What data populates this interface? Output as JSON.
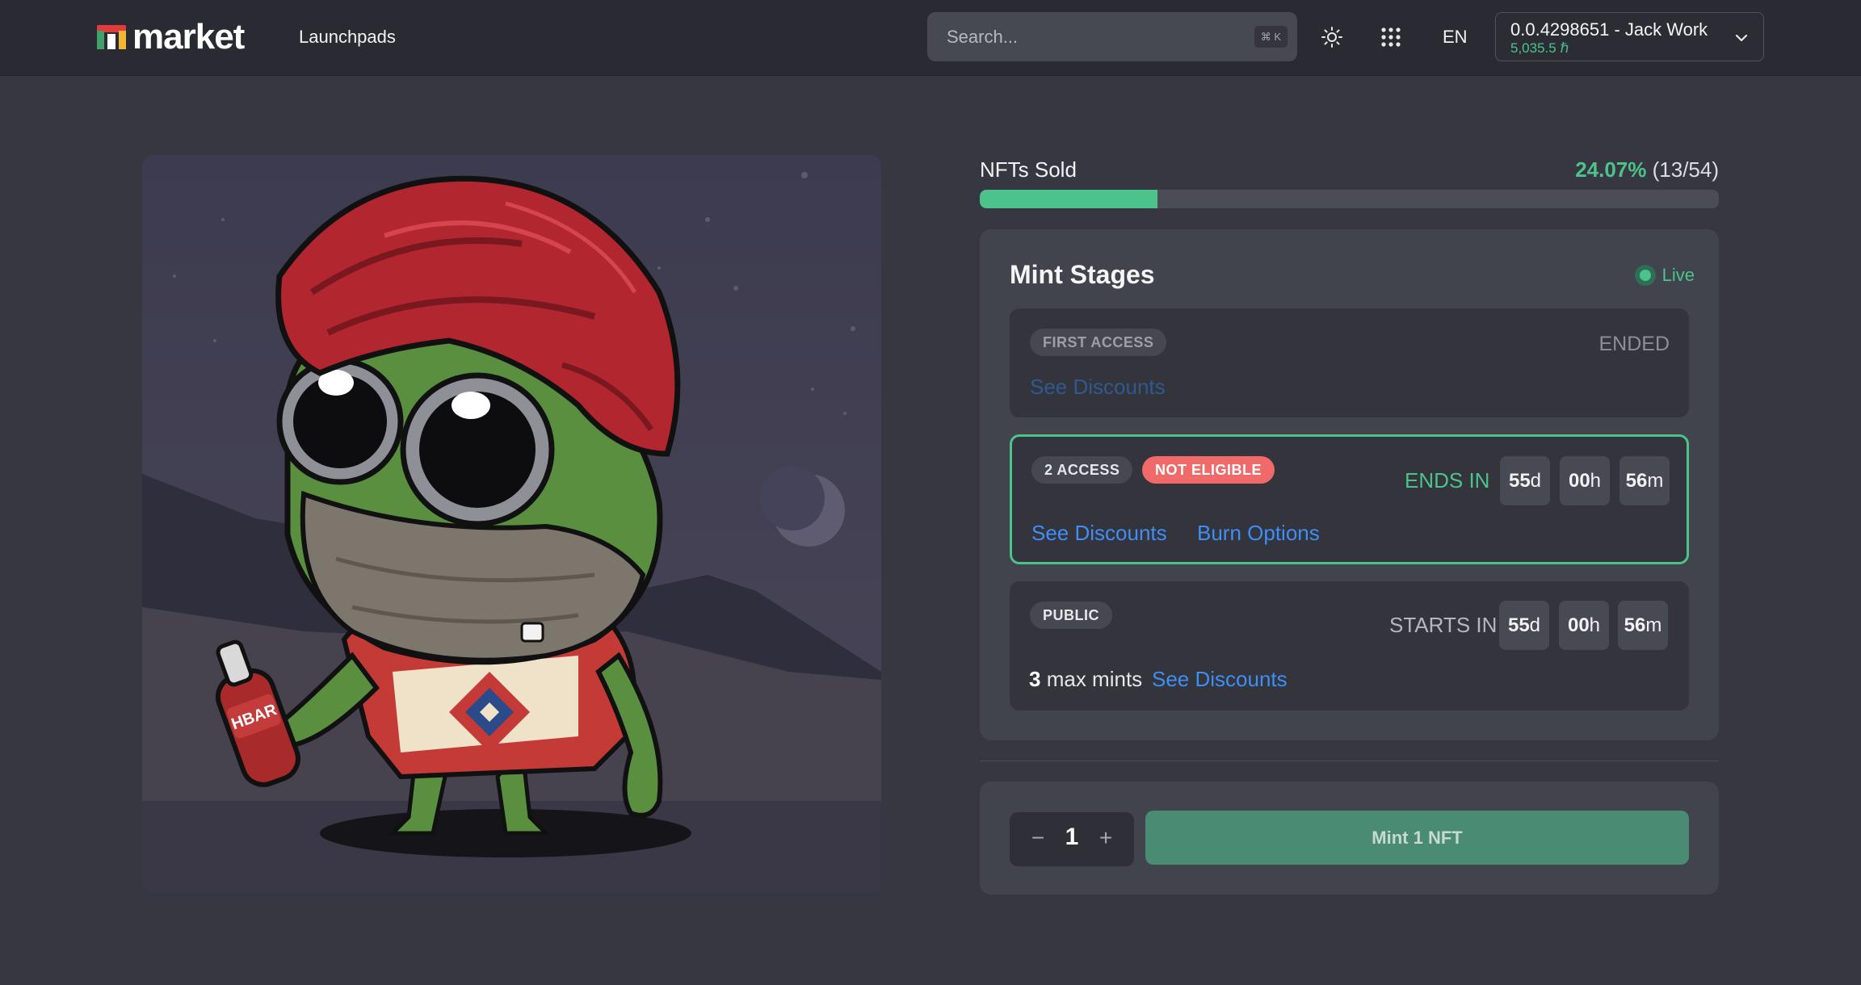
{
  "header": {
    "logo_text": "market",
    "nav_launchpads": "Launchpads",
    "search_placeholder": "Search...",
    "search_shortcut": "⌘ K",
    "language": "EN",
    "account_name": "0.0.4298651 - Jack Work",
    "account_balance": "5,035.5 ℏ"
  },
  "sale": {
    "sold_label": "NFTs Sold",
    "sold_percent": "24.07%",
    "sold_count": "(13/54)",
    "progress_fraction": 0.2407
  },
  "mint_stages": {
    "title": "Mint Stages",
    "status": "Live",
    "stages": [
      {
        "name": "FIRST ACCESS",
        "status": "ENDED",
        "link1": "See Discounts"
      },
      {
        "name": "2 ACCESS",
        "badge": "NOT ELIGIBLE",
        "timer_label": "ENDS IN",
        "days": "55",
        "days_unit": "d",
        "hours": "00",
        "hours_unit": "h",
        "minutes": "56",
        "minutes_unit": "m",
        "link1": "See Discounts",
        "link2": "Burn Options"
      },
      {
        "name": "PUBLIC",
        "timer_label": "STARTS IN",
        "days": "55",
        "days_unit": "d",
        "hours": "00",
        "hours_unit": "h",
        "minutes": "56",
        "minutes_unit": "m",
        "max_mints_count": "3",
        "max_mints_label": "max mints",
        "link1": "See Discounts"
      }
    ]
  },
  "mint": {
    "quantity": "1",
    "minus": "−",
    "plus": "+",
    "button_label": "Mint 1 NFT"
  },
  "artwork": {
    "bottle_label": "HBAR"
  },
  "colors": {
    "accent_green": "#4cc38a",
    "link_blue": "#3f8ef5",
    "badge_red": "#f06a6a",
    "background": "#363740",
    "header_bg": "#2a2b32"
  }
}
